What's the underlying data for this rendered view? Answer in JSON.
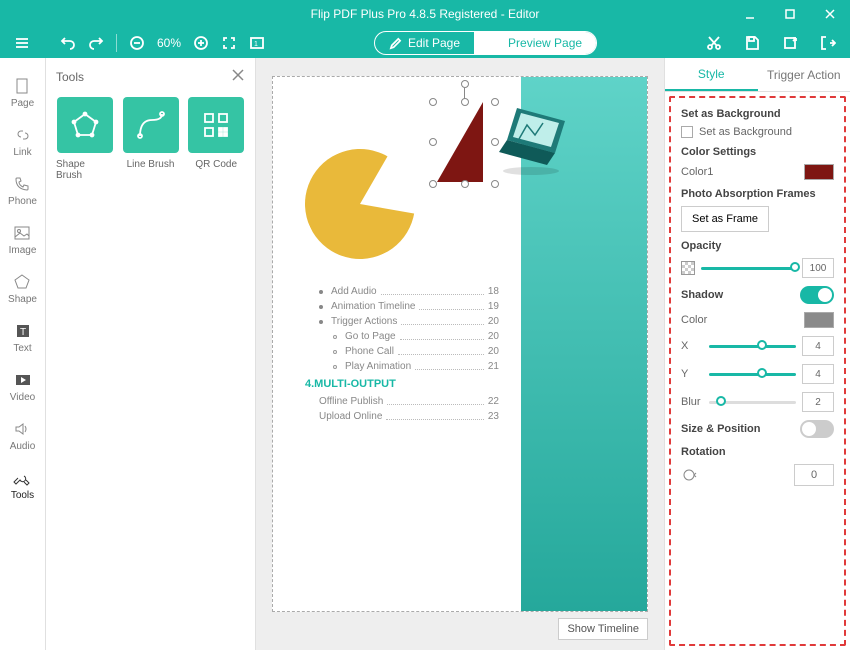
{
  "app": {
    "title": "Flip PDF Plus Pro 4.8.5 Registered - Editor"
  },
  "toolbar": {
    "zoom": "60%",
    "edit_label": "Edit Page",
    "preview_label": "Preview Page"
  },
  "rail": {
    "items": [
      {
        "label": "Page"
      },
      {
        "label": "Link"
      },
      {
        "label": "Phone"
      },
      {
        "label": "Image"
      },
      {
        "label": "Shape"
      },
      {
        "label": "Text"
      },
      {
        "label": "Video"
      },
      {
        "label": "Audio"
      },
      {
        "label": "Tools"
      }
    ]
  },
  "tools_panel": {
    "title": "Tools",
    "cards": [
      {
        "label": "Shape Brush"
      },
      {
        "label": "Line Brush"
      },
      {
        "label": "QR Code"
      }
    ]
  },
  "canvas": {
    "toc": [
      {
        "indent": 1,
        "bullet": "solid",
        "text": "Add Audio",
        "page": "18"
      },
      {
        "indent": 1,
        "bullet": "solid",
        "text": "Animation Timeline",
        "page": "19"
      },
      {
        "indent": 1,
        "bullet": "solid",
        "text": "Trigger Actions",
        "page": "20"
      },
      {
        "indent": 2,
        "bullet": "hollow",
        "text": "Go to Page",
        "page": "20"
      },
      {
        "indent": 2,
        "bullet": "hollow",
        "text": "Phone Call",
        "page": "20"
      },
      {
        "indent": 2,
        "bullet": "hollow",
        "text": "Play Animation",
        "page": "21"
      }
    ],
    "section_heading": "4.MULTI-OUTPUT",
    "toc2": [
      {
        "indent": 1,
        "text": "Offline Publish",
        "page": "22"
      },
      {
        "indent": 1,
        "text": "Upload Online",
        "page": "23"
      }
    ],
    "show_timeline": "Show Timeline"
  },
  "right": {
    "tabs": {
      "style": "Style",
      "trigger": "Trigger Action"
    },
    "set_bg_header": "Set as Background",
    "set_bg_label": "Set as Background",
    "color_settings": "Color Settings",
    "color1_label": "Color1",
    "color1_value": "#7e1612",
    "photo_frames": "Photo Absorption Frames",
    "set_frame": "Set as Frame",
    "opacity": "Opacity",
    "opacity_value": "100",
    "shadow": "Shadow",
    "shadow_on": true,
    "shadow_color_label": "Color",
    "shadow_color": "#8a8a8a",
    "shadow_x_label": "X",
    "shadow_x": "4",
    "shadow_y_label": "Y",
    "shadow_y": "4",
    "shadow_blur_label": "Blur",
    "shadow_blur": "2",
    "size_pos": "Size & Position",
    "rotation": "Rotation",
    "rotation_value": "0"
  }
}
